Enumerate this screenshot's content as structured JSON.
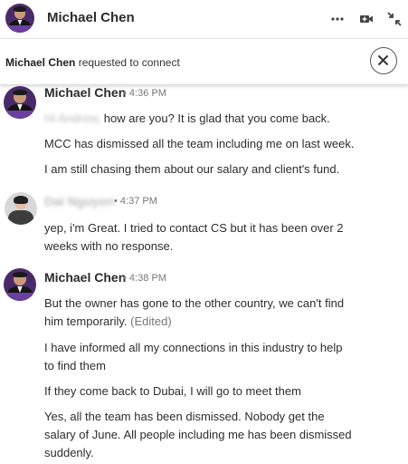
{
  "header": {
    "name": "Michael Chen",
    "icons": [
      "more-icon",
      "video-call-icon",
      "minimize-icon"
    ]
  },
  "banner": {
    "name": "Michael Chen",
    "text": "requested to connect",
    "close_icon": "close-icon"
  },
  "messages": [
    {
      "sender": "Michael Chen",
      "time": "4:36 PM",
      "lines": [
        {
          "redacted": "Hi Andrew,",
          "text": " how are you? It is glad that you come back."
        },
        {
          "text": "MCC has dismissed all the team including me on last week."
        },
        {
          "text": "I am still chasing them about our salary and client's fund."
        }
      ]
    },
    {
      "sender": "Dai Nguyen",
      "time": "4:37 PM",
      "lines": [
        {
          "text": "yep, i'm Great. I tried to contact CS but it has been over 2"
        },
        {
          "text": "weeks with no response."
        }
      ]
    },
    {
      "sender": "Michael Chen",
      "time": "4:38 PM",
      "lines": [
        {
          "text": "But the owner has gone to the other country, we can't find"
        },
        {
          "text": "him temporarily.",
          "edited": "(Edited)"
        },
        {
          "text": "I have informed all my connections in this industry to help"
        },
        {
          "text": "to find them"
        },
        {
          "text": "If they come back to Dubai, I will go to meet them"
        },
        {
          "text": "Yes, all the team has been dismissed. Nobody get the"
        },
        {
          "text": "salary of June. All people including me has been dismissed"
        },
        {
          "text": "suddenly."
        }
      ]
    }
  ]
}
